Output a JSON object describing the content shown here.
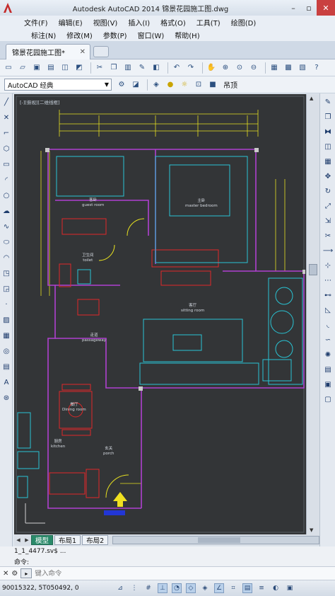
{
  "window": {
    "title": "Autodesk AutoCAD 2014    锦景花园施工图.dwg"
  },
  "menu": {
    "row1": [
      "文件(F)",
      "编辑(E)",
      "视图(V)",
      "插入(I)",
      "格式(O)",
      "工具(T)",
      "绘图(D)"
    ],
    "row2": [
      "标注(N)",
      "修改(M)",
      "参数(P)",
      "窗口(W)",
      "帮助(H)"
    ]
  },
  "tabs": {
    "document": "锦景花园施工图*"
  },
  "toolbar": {
    "workspace": "AutoCAD 经典",
    "layer": "吊顶"
  },
  "drawing": {
    "viewport_label": "[-][俯视][二维线框]",
    "rooms": [
      {
        "name": "客卧",
        "sub": "guest room"
      },
      {
        "name": "主卧",
        "sub": "master bedroom"
      },
      {
        "name": "卫生间",
        "sub": "toilet"
      },
      {
        "name": "客厅",
        "sub": "sitting room"
      },
      {
        "name": "走道",
        "sub": "passageway"
      },
      {
        "name": "餐厅",
        "sub": "Dining room"
      },
      {
        "name": "厨房",
        "sub": "kitchen"
      },
      {
        "name": "玄关",
        "sub": "porch"
      }
    ]
  },
  "layouts": {
    "tabs": [
      "模型",
      "布局1",
      "布局2"
    ],
    "active": "模型"
  },
  "command": {
    "history": "1_1_4477.sv$ ...",
    "prompt": "命令:",
    "placeholder": "键入命令"
  },
  "status": {
    "coordinates": "90015322, 5T050492, 0"
  },
  "colors": {
    "canvas_bg": "#333537",
    "wall_purple": "#b040d0",
    "furniture_cyan": "#29c4d4",
    "furniture_red": "#e02828",
    "dimension_yellow": "#e6e020"
  }
}
